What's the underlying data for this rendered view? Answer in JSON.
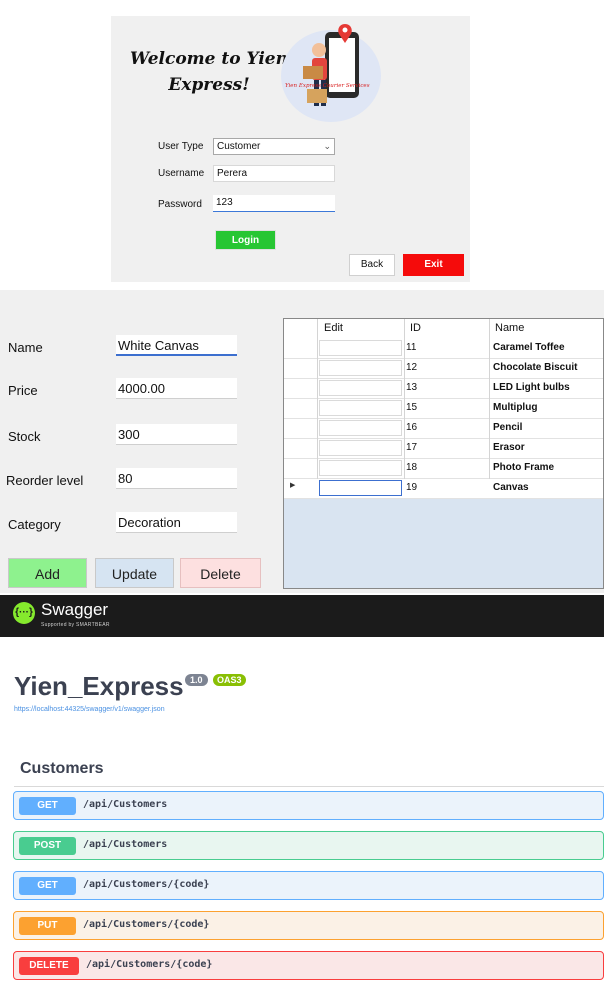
{
  "login": {
    "welcome_line1": "Welcome to Yien",
    "welcome_line2": "Express!",
    "logo_text": "Yien Express Courier Services",
    "usertype_label": "User Type",
    "usertype_value": "Customer",
    "username_label": "Username",
    "username_value": "Perera",
    "password_label": "Password",
    "password_value": "123",
    "login_button": "Login",
    "back_button": "Back",
    "exit_button": "Exit"
  },
  "product_form": {
    "fields": [
      {
        "label": "Name",
        "value": "White Canvas"
      },
      {
        "label": "Price",
        "value": "4000.00"
      },
      {
        "label": "Stock",
        "value": "300"
      },
      {
        "label": "Reorder level",
        "value": "80"
      },
      {
        "label": "Category",
        "value": "Decoration"
      }
    ],
    "buttons": {
      "add": "Add",
      "update": "Update",
      "delete": "Delete"
    },
    "colors": {
      "add": "#8ef28e",
      "update": "#d6e4f2",
      "delete": "#fde0e0"
    }
  },
  "grid": {
    "columns": [
      "Edit",
      "ID",
      "Name"
    ],
    "rows": [
      {
        "id": "11",
        "name": "Caramel Toffee"
      },
      {
        "id": "12",
        "name": "Chocolate Biscuit"
      },
      {
        "id": "13",
        "name": "LED Light bulbs"
      },
      {
        "id": "15",
        "name": "Multiplug"
      },
      {
        "id": "16",
        "name": "Pencil"
      },
      {
        "id": "17",
        "name": "Erasor"
      },
      {
        "id": "18",
        "name": "Photo Frame"
      },
      {
        "id": "19",
        "name": "Canvas"
      }
    ],
    "current_row_marker": "▶"
  },
  "swagger": {
    "brand": "Swagger",
    "brand_sub": "Supported by SMARTBEAR",
    "logo_icon": "{···}",
    "api_title": "Yien_Express",
    "version": "1.0",
    "oas": "OAS3",
    "spec_url": "https://localhost:44325/swagger/v1/swagger.json",
    "section": "Customers",
    "operations": [
      {
        "method": "GET",
        "path": "/api/Customers"
      },
      {
        "method": "POST",
        "path": "/api/Customers"
      },
      {
        "method": "GET",
        "path": "/api/Customers/{code}"
      },
      {
        "method": "PUT",
        "path": "/api/Customers/{code}"
      },
      {
        "method": "DELETE",
        "path": "/api/Customers/{code}"
      }
    ],
    "colors": {
      "get": "#61affe",
      "post": "#49cc90",
      "put": "#fca130",
      "delete": "#f93e3e",
      "logo": "#85ea2d"
    }
  }
}
